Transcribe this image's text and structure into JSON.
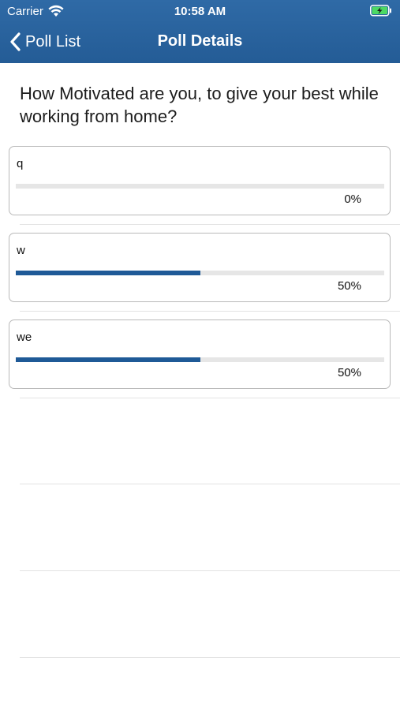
{
  "status_bar": {
    "carrier": "Carrier",
    "time": "10:58 AM"
  },
  "nav": {
    "back_label": "Poll List",
    "title": "Poll Details"
  },
  "poll": {
    "question": "How Motivated are you, to give your best while working from home?",
    "options": [
      {
        "label": "q",
        "percent_text": "0%",
        "fraction": 0.0
      },
      {
        "label": "w",
        "percent_text": "50%",
        "fraction": 0.5
      },
      {
        "label": "we",
        "percent_text": "50%",
        "fraction": 0.5
      }
    ]
  },
  "colors": {
    "nav_bar": "#2f6aa6",
    "progress_fill": "#1f5a97",
    "progress_track": "#e6e6e6",
    "battery": "#4cd964"
  },
  "icons": [
    "wifi-icon",
    "battery-charging-icon",
    "chevron-left-icon"
  ]
}
